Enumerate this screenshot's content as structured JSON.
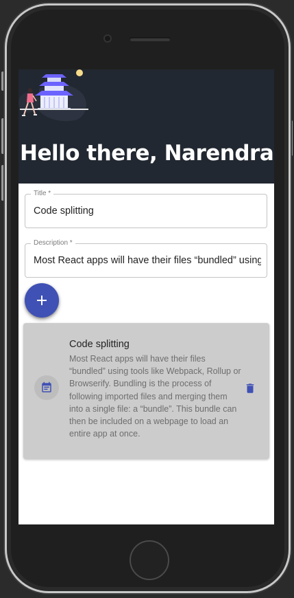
{
  "header": {
    "greeting": "Hello there, Narendra!"
  },
  "form": {
    "title_label": "Title *",
    "title_value": "Code splitting",
    "description_label": "Description *",
    "description_value": "Most React apps will have their files “bundled” using tools like Webpack, Rollup or Browserify.",
    "add_button_symbol": "+"
  },
  "notes": [
    {
      "title": "Code splitting",
      "body": "Most React apps will have their files “bundled” using tools like Webpack, Rollup or Browserify. Bundling is the process of following imported files and merging them into a single file: a “bundle”. This bundle can then be included on a webpage to load an entire app at once."
    }
  ],
  "icons": {
    "add": "plus-icon",
    "note": "event-note-icon",
    "delete": "trash-icon"
  },
  "colors": {
    "header_bg": "#222831",
    "accent": "#3f51b5",
    "card_bg": "#cccccc",
    "illustration_primary": "#6c63ff"
  }
}
